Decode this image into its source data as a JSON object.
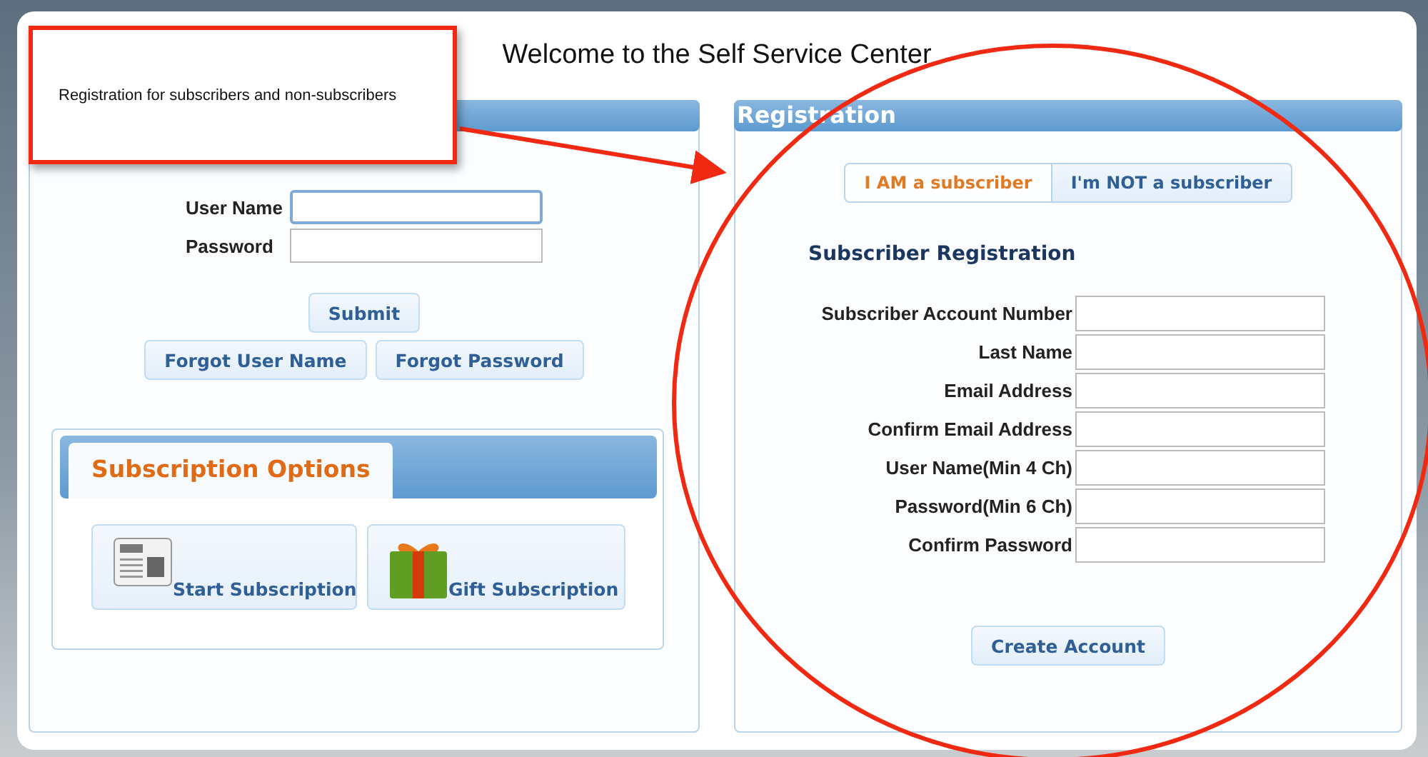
{
  "callout": {
    "text": "Registration for subscribers and non-subscribers"
  },
  "title": "Welcome to the Self Service Center",
  "login": {
    "fields": [
      {
        "label": "User Name",
        "focused": true
      },
      {
        "label": "Password",
        "focused": false
      }
    ],
    "submit": "Submit",
    "links": [
      "Forgot User Name",
      "Forgot Password"
    ]
  },
  "subscription_options": {
    "tab": "Subscription Options",
    "options": [
      {
        "kind": "news",
        "label": "Start Subscription"
      },
      {
        "kind": "gift",
        "label": "Gift Subscription"
      }
    ]
  },
  "registration": {
    "title": "Registration",
    "tabs": [
      {
        "label": "I AM a subscriber",
        "selected": true
      },
      {
        "label": "I'm NOT a subscriber",
        "selected": false
      }
    ],
    "heading": "Subscriber Registration",
    "fields": [
      "Subscriber Account Number",
      "Last Name",
      "Email Address",
      "Confirm Email Address",
      "User Name(Min 4 Ch)",
      "Password(Min 6 Ch)",
      "Confirm Password"
    ],
    "button": "Create Account"
  }
}
